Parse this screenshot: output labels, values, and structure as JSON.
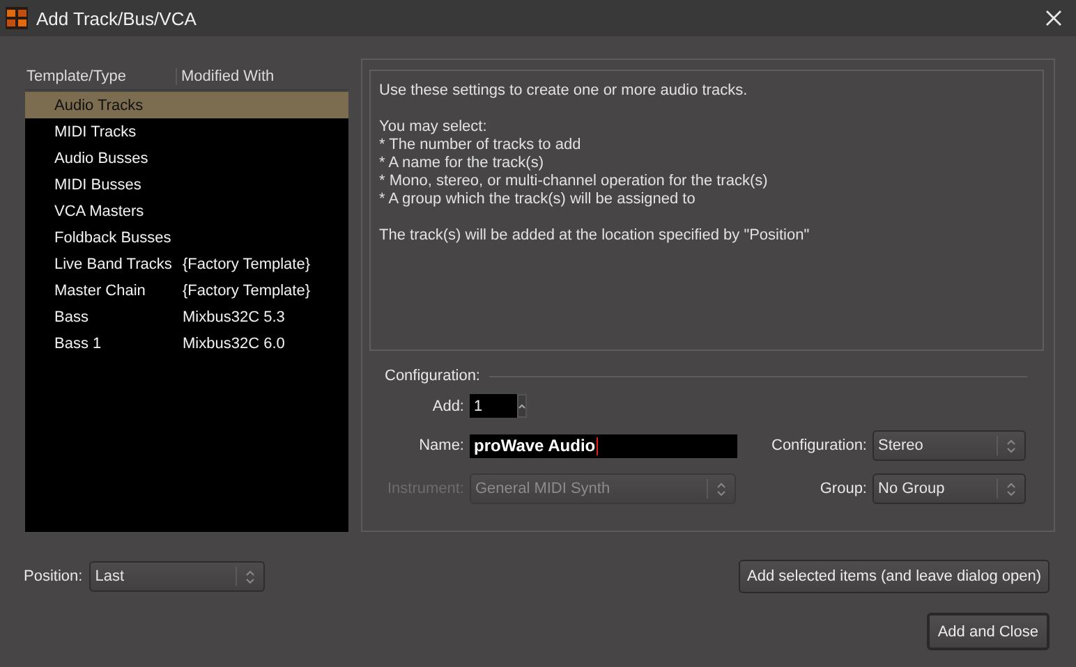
{
  "window": {
    "title": "Add Track/Bus/VCA"
  },
  "template_list": {
    "columns": [
      "Template/Type",
      "Modified With"
    ],
    "rows": [
      {
        "name": "Audio Tracks",
        "modified_with": null,
        "selected": true
      },
      {
        "name": "MIDI Tracks",
        "modified_with": null,
        "selected": false
      },
      {
        "name": "Audio Busses",
        "modified_with": null,
        "selected": false
      },
      {
        "name": "MIDI Busses",
        "modified_with": null,
        "selected": false
      },
      {
        "name": "VCA Masters",
        "modified_with": null,
        "selected": false
      },
      {
        "name": "Foldback Busses",
        "modified_with": null,
        "selected": false
      },
      {
        "name": "Live Band Tracks",
        "modified_with": "{Factory Template}",
        "selected": false
      },
      {
        "name": "Master Chain",
        "modified_with": "{Factory Template}",
        "selected": false
      },
      {
        "name": "Bass",
        "modified_with": "Mixbus32C 5.3",
        "selected": false
      },
      {
        "name": "Bass 1",
        "modified_with": "Mixbus32C 6.0",
        "selected": false
      }
    ]
  },
  "description": [
    "Use these settings to create one or more audio tracks.",
    "You may select:\n* The number of tracks to add\n* A name for the track(s)\n* Mono, stereo, or multi-channel operation for the track(s)\n* A group which the track(s) will be assigned to",
    "The track(s) will be added at the location specified by \"Position\""
  ],
  "configuration": {
    "title": "Configuration:",
    "add": {
      "label": "Add:",
      "value": "1"
    },
    "name": {
      "label": "Name:",
      "value": "proWave Audio",
      "focused": true
    },
    "channels": {
      "label": "Configuration:",
      "value": "Stereo",
      "disabled": false
    },
    "instrument": {
      "label": "Instrument:",
      "value": "General MIDI Synth",
      "disabled": true
    },
    "group": {
      "label": "Group:",
      "value": "No Group",
      "disabled": false
    }
  },
  "position": {
    "label": "Position:",
    "value": "Last"
  },
  "buttons": [
    {
      "label": "Add selected items (and leave dialog open)",
      "default": false
    },
    {
      "label": "Add and Close",
      "default": true
    }
  ]
}
